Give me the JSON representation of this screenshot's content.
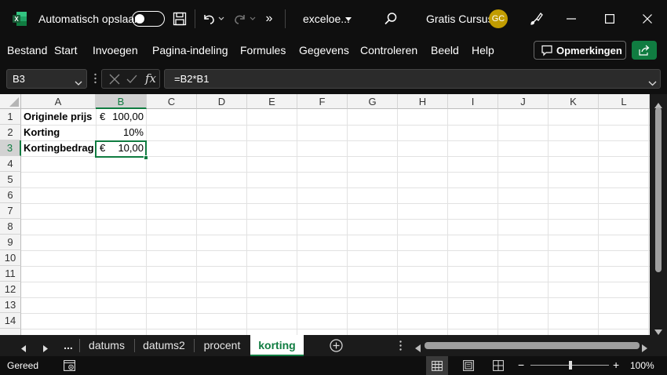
{
  "titlebar": {
    "autosave_label": "Automatisch opslaan",
    "filename": "exceloe...",
    "account_name": "Gratis Cursus",
    "avatar_initials": "GC",
    "overflow_glyph": "»"
  },
  "menu": {
    "items": [
      "Bestand",
      "Start",
      "Invoegen",
      "Pagina-indeling",
      "Formules",
      "Gegevens",
      "Controleren",
      "Beeld",
      "Help"
    ],
    "comments_button": "Opmerkingen"
  },
  "formula_bar": {
    "name_box": "B3",
    "formula": "=B2*B1",
    "fx_label": "fx"
  },
  "sheet": {
    "columns": [
      "A",
      "B",
      "C",
      "D",
      "E",
      "F",
      "G",
      "H",
      "I",
      "J",
      "K",
      "L"
    ],
    "selected_column": "B",
    "rows": [
      "1",
      "2",
      "3",
      "4",
      "5",
      "6",
      "7",
      "8",
      "9",
      "10",
      "11",
      "12",
      "13",
      "14"
    ],
    "selected_row": "3",
    "selected_cell": "B3",
    "cells": {
      "A1": "Originele prijs",
      "A2": "Korting",
      "A3": "Kortingbedrag",
      "B1_symbol": "€",
      "B1_value": "100,00",
      "B2": "10%",
      "B3_symbol": "€",
      "B3_value": "10,00"
    }
  },
  "tabs": {
    "ellipsis": "...",
    "sheets": [
      "datums",
      "datums2",
      "procent",
      "korting"
    ],
    "active": "korting"
  },
  "status": {
    "ready_label": "Gereed",
    "zoom": "100%",
    "zoom_minus": "−",
    "zoom_plus": "+"
  },
  "colors": {
    "accent_green": "#107c41",
    "active_tab_text": "#107c41",
    "avatar_bg": "#c19c00",
    "header_selected": "#d2d2d2"
  },
  "icons": [
    "excel-logo-icon",
    "save-icon",
    "undo-icon",
    "redo-icon",
    "search-icon",
    "brush-icon",
    "minimize-icon",
    "maximize-icon",
    "close-icon",
    "comment-icon",
    "share-icon",
    "cancel-icon",
    "check-icon",
    "add-sheet-icon",
    "normal-view-icon",
    "page-layout-icon",
    "page-break-icon",
    "macro-record-icon"
  ]
}
